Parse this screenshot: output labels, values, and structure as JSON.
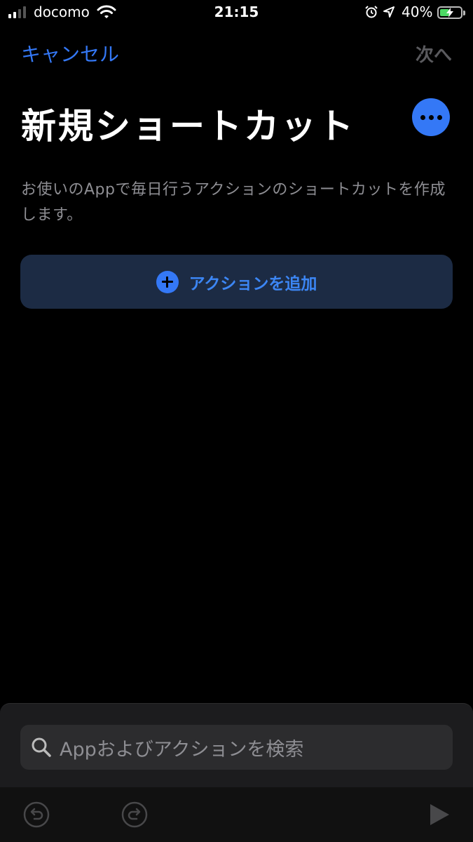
{
  "status_bar": {
    "carrier": "docomo",
    "time": "21:15",
    "battery": "40%"
  },
  "nav": {
    "cancel": "キャンセル",
    "next": "次へ"
  },
  "page": {
    "title": "新規ショートカット",
    "description": "お使いのAppで毎日行うアクションのショートカットを作成します。"
  },
  "add_action": {
    "label": "アクションを追加"
  },
  "search": {
    "placeholder": "Appおよびアクションを検索"
  },
  "colors": {
    "accent": "#3478f6",
    "background": "#000000",
    "add_button_bg": "#1c2b44",
    "disabled": "#5a5a5e"
  },
  "icons": [
    "signal-icon",
    "wifi-icon",
    "alarm-icon",
    "location-icon",
    "battery-icon",
    "more-icon",
    "plus-icon",
    "search-icon",
    "undo-icon",
    "redo-icon",
    "play-icon"
  ]
}
